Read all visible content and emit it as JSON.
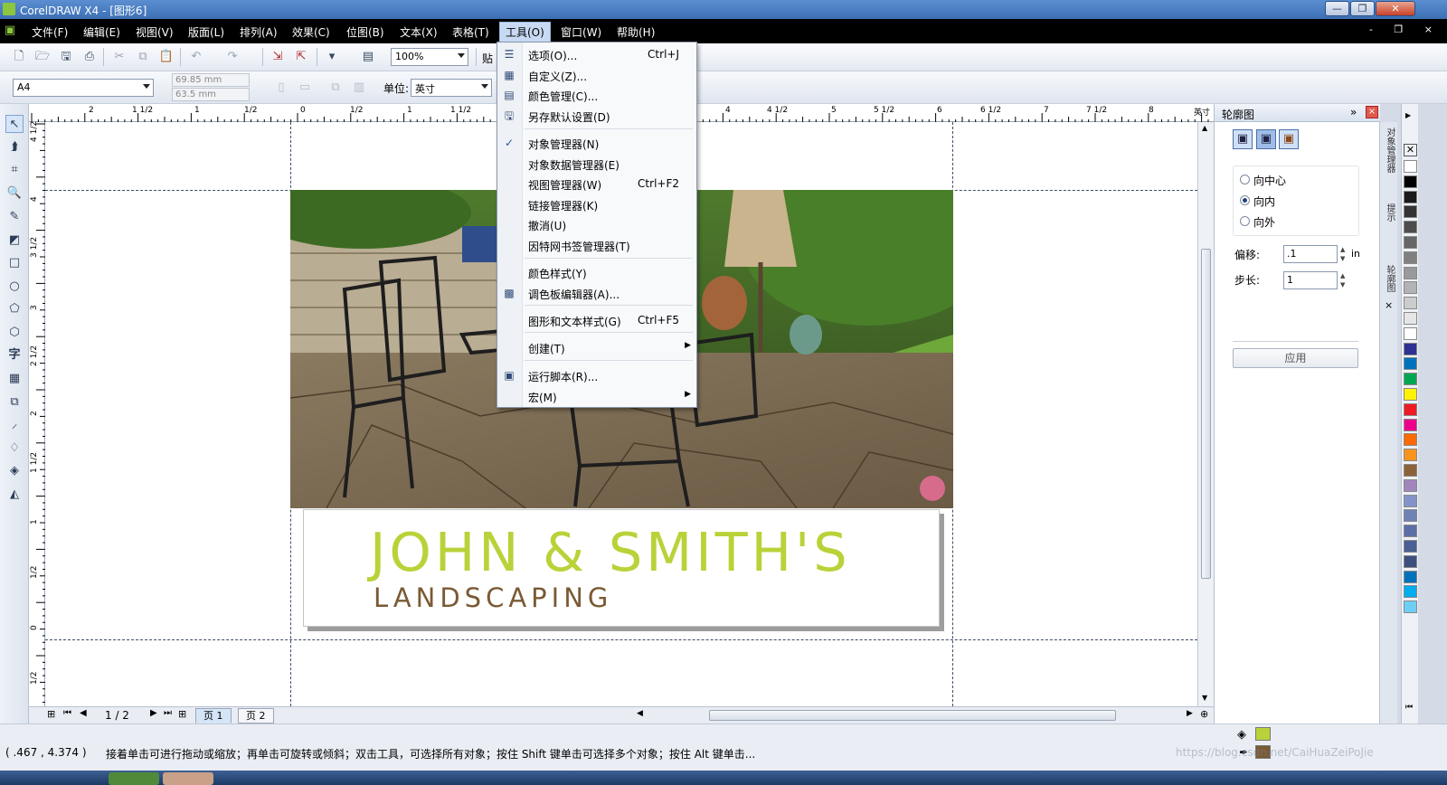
{
  "window": {
    "title": "CorelDRAW X4 - [图形6]",
    "minimize": "—",
    "restore": "❐",
    "close": "✕"
  },
  "menubar": {
    "items": [
      "文件(F)",
      "编辑(E)",
      "视图(V)",
      "版面(L)",
      "排列(A)",
      "效果(C)",
      "位图(B)",
      "文本(X)",
      "表格(T)",
      "工具(O)",
      "窗口(W)",
      "帮助(H)"
    ],
    "active_index": 9,
    "doc_controls": "- ❐ ×"
  },
  "toolbar": {
    "zoom": "100%",
    "paste_partial": "贴"
  },
  "propertybar": {
    "page_size": "A4",
    "width": "69.85 mm",
    "height": "63.5 mm",
    "units_label": "单位:",
    "units_value": "英寸"
  },
  "tools_menu": {
    "items": [
      {
        "label": "选项(O)...",
        "shortcut": "Ctrl+J",
        "icon": "options-icon"
      },
      {
        "label": "自定义(Z)...",
        "shortcut": "",
        "icon": "customize-icon"
      },
      {
        "label": "颜色管理(C)...",
        "shortcut": "",
        "icon": "color-management-icon"
      },
      {
        "label": "另存默认设置(D)",
        "shortcut": "",
        "icon": "save-defaults-icon"
      },
      {
        "label": "对象管理器(N)",
        "shortcut": "",
        "icon": "checkmark-icon"
      },
      {
        "label": "对象数据管理器(E)",
        "shortcut": "",
        "icon": ""
      },
      {
        "label": "视图管理器(W)",
        "shortcut": "Ctrl+F2",
        "icon": ""
      },
      {
        "label": "链接管理器(K)",
        "shortcut": "",
        "icon": ""
      },
      {
        "label": "撤消(U)",
        "shortcut": "",
        "icon": ""
      },
      {
        "label": "因特网书签管理器(T)",
        "shortcut": "",
        "icon": ""
      },
      {
        "label": "颜色样式(Y)",
        "shortcut": "",
        "icon": ""
      },
      {
        "label": "调色板编辑器(A)...",
        "shortcut": "",
        "icon": "palette-editor-icon"
      },
      {
        "label": "图形和文本样式(G)",
        "shortcut": "Ctrl+F5",
        "icon": ""
      },
      {
        "label": "创建(T)",
        "shortcut": "",
        "icon": "",
        "submenu": true
      },
      {
        "label": "运行脚本(R)...",
        "shortcut": "",
        "icon": "run-script-icon"
      },
      {
        "label": "宏(M)",
        "shortcut": "",
        "icon": "",
        "submenu": true
      }
    ]
  },
  "rulers": {
    "h_labels": [
      "2",
      "1 1/2",
      "1",
      "1/2",
      "0",
      "1/2",
      "1",
      "1 1/2",
      "4",
      "4 1/2",
      "5",
      "5 1/2",
      "6",
      "6 1/2",
      "7",
      "7 1/2",
      "8",
      "英寸"
    ],
    "v_labels": [
      "4 1/2",
      "4",
      "3 1/2",
      "3",
      "2 1/2",
      "2",
      "1 1/2",
      "1",
      "1/2",
      "0",
      "1/2"
    ]
  },
  "artwork": {
    "headline": "JOHN & SMITH'S",
    "subline": "LANDSCAPING",
    "headline_color": "#b9d239",
    "subline_color": "#7a5a34"
  },
  "pages": {
    "counter": "1 / 2",
    "tabs": [
      "页 1",
      "页 2"
    ],
    "active": 0
  },
  "docker": {
    "title": "轮廓图",
    "options": [
      "向中心",
      "向内",
      "向外"
    ],
    "selected": 1,
    "offset_label": "偏移:",
    "offset_value": ".1",
    "offset_unit": "in",
    "steps_label": "步长:",
    "steps_value": "1",
    "apply": "应用"
  },
  "side_tabs": [
    "对象管理器",
    "提示",
    "轮廓图"
  ],
  "palette_colors": [
    "#ffffff",
    "#000000",
    "#1a1a1a",
    "#333333",
    "#4d4d4d",
    "#666666",
    "#808080",
    "#999999",
    "#b3b3b3",
    "#cccccc",
    "#e6e6e6",
    "#ffffff",
    "#2e3192",
    "#0072bc",
    "#00a651",
    "#fff200",
    "#ed1c24",
    "#ec008c",
    "#ff6a00",
    "#f7941d",
    "#8c6239",
    "#a186be",
    "#8393ca",
    "#6d83b6",
    "#5b6fa8",
    "#4a5f95",
    "#3d4f7f",
    "#0072bc",
    "#00aeef",
    "#6dcff6"
  ],
  "status": {
    "coords": "( .467 , 4.374 )",
    "message": "接着单击可进行拖动或缩放；再单击可旋转或倾斜；双击工具，可选择所有对象；按住 Shift 键单击可选择多个对象；按住 Alt 键单击...",
    "watermark": "https://blog.csdn.net/CaiHuaZeiPoJie",
    "fill_color": "#b9d239",
    "outline_color": "#7a5a34"
  }
}
